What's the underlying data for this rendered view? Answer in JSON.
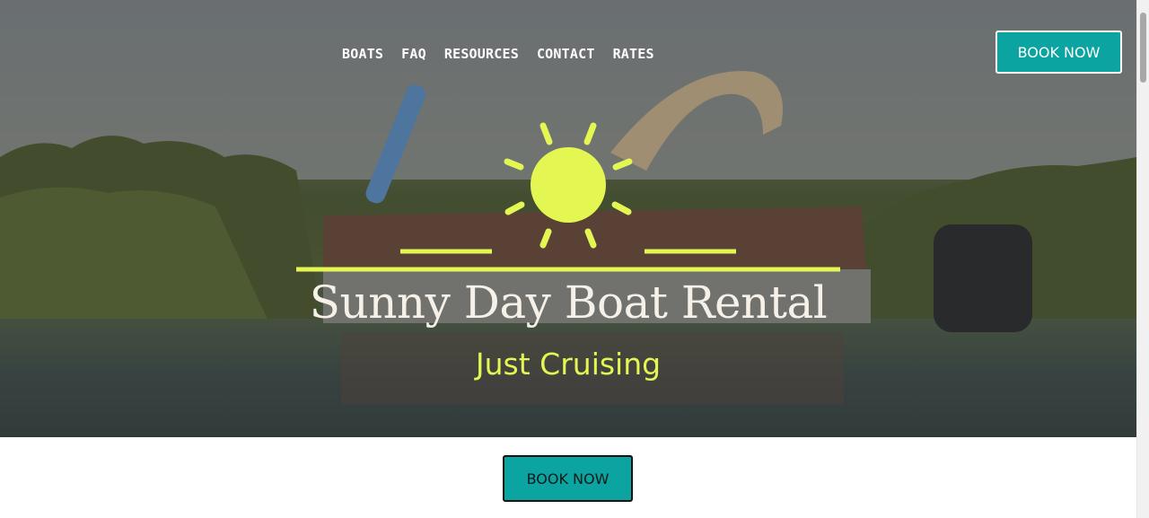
{
  "nav": {
    "items": [
      "BOATS",
      "FAQ",
      "RESOURCES",
      "CONTACT",
      "RATES"
    ]
  },
  "header": {
    "book_button_label": "BOOK NOW"
  },
  "hero": {
    "title": "Sunny Day Boat Rental",
    "subtitle": "Just Cruising",
    "sun_icon": "sun-icon",
    "accent_color": "#e4f652"
  },
  "main": {
    "book_button_label": "BOOK NOW"
  },
  "colors": {
    "button_teal": "#0ba4a0",
    "title_color": "#f5f1e8"
  }
}
